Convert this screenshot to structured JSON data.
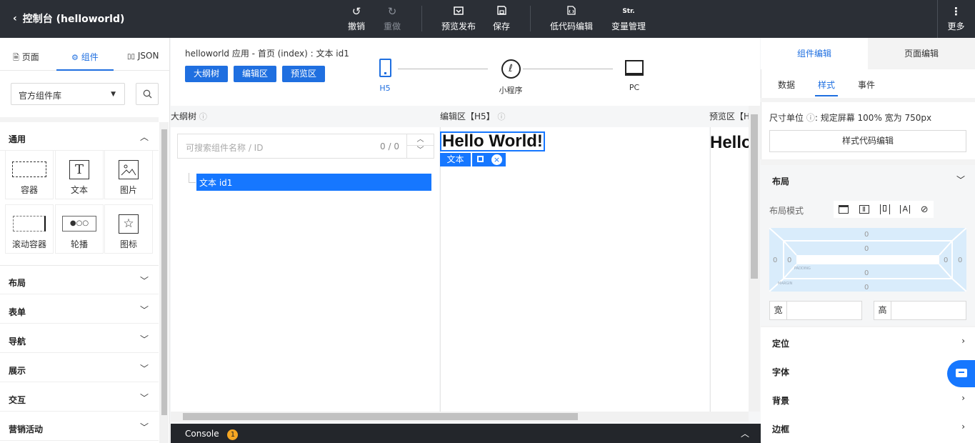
{
  "topbar": {
    "back_title": "控制台 (helloworld)",
    "undo": "撤销",
    "redo": "重做",
    "preview_publish": "预览发布",
    "save": "保存",
    "lowcode_edit": "低代码编辑",
    "variable_manage": "变量管理",
    "more": "更多",
    "variable_icon_text": "Str."
  },
  "left_tabs": {
    "page": "页面",
    "components": "组件",
    "json": "JSON"
  },
  "library": {
    "selected": "官方组件库"
  },
  "sections": {
    "general": "通用",
    "layout": "布局",
    "form": "表单",
    "navigation": "导航",
    "display": "展示",
    "interaction": "交互",
    "marketing": "营销活动"
  },
  "components": [
    "容器",
    "文本",
    "图片",
    "滚动容器",
    "轮播",
    "图标"
  ],
  "breadcrumb": "helloworld 应用 - 首页 (index) : 文本 id1",
  "view_buttons": {
    "outline": "大纲树",
    "editor": "编辑区",
    "preview": "预览区"
  },
  "devices": {
    "h5": "H5",
    "mini": "小程序",
    "pc": "PC"
  },
  "columns": {
    "outline": "大纲树",
    "editor": "编辑区【H5】",
    "preview": "预览区【H"
  },
  "outline": {
    "search_placeholder": "可搜索组件名称 / ID",
    "count": "0 / 0",
    "node": "文本 id1"
  },
  "canvas": {
    "hello": "Hello World!",
    "selected_tag": "文本",
    "preview_hello": "Hello"
  },
  "console": {
    "label": "Console",
    "badge": "1"
  },
  "right": {
    "tab_component": "组件编辑",
    "tab_page": "页面编辑",
    "sub_data": "数据",
    "sub_style": "样式",
    "sub_event": "事件",
    "unit_label": "尺寸单位",
    "unit_desc": "规定屏幕 100% 宽为 750px",
    "style_code_btn": "样式代码编辑",
    "layout": "布局",
    "layout_mode": "布局模式",
    "width": "宽",
    "height": "高",
    "position": "定位",
    "font": "字体",
    "background": "背景",
    "border": "边框",
    "box_values": {
      "margin_top": "0",
      "padding_top": "0",
      "padding_bottom": "0",
      "margin_bottom": "0",
      "margin_left": "0",
      "padding_left": "0",
      "padding_right": "0",
      "margin_right": "0"
    },
    "padding_label": "PADDING",
    "margin_label": "MARGIN"
  },
  "colors": {
    "accent": "#1f6fe0",
    "topbar": "#2b2f36",
    "selection": "#1677ff"
  }
}
